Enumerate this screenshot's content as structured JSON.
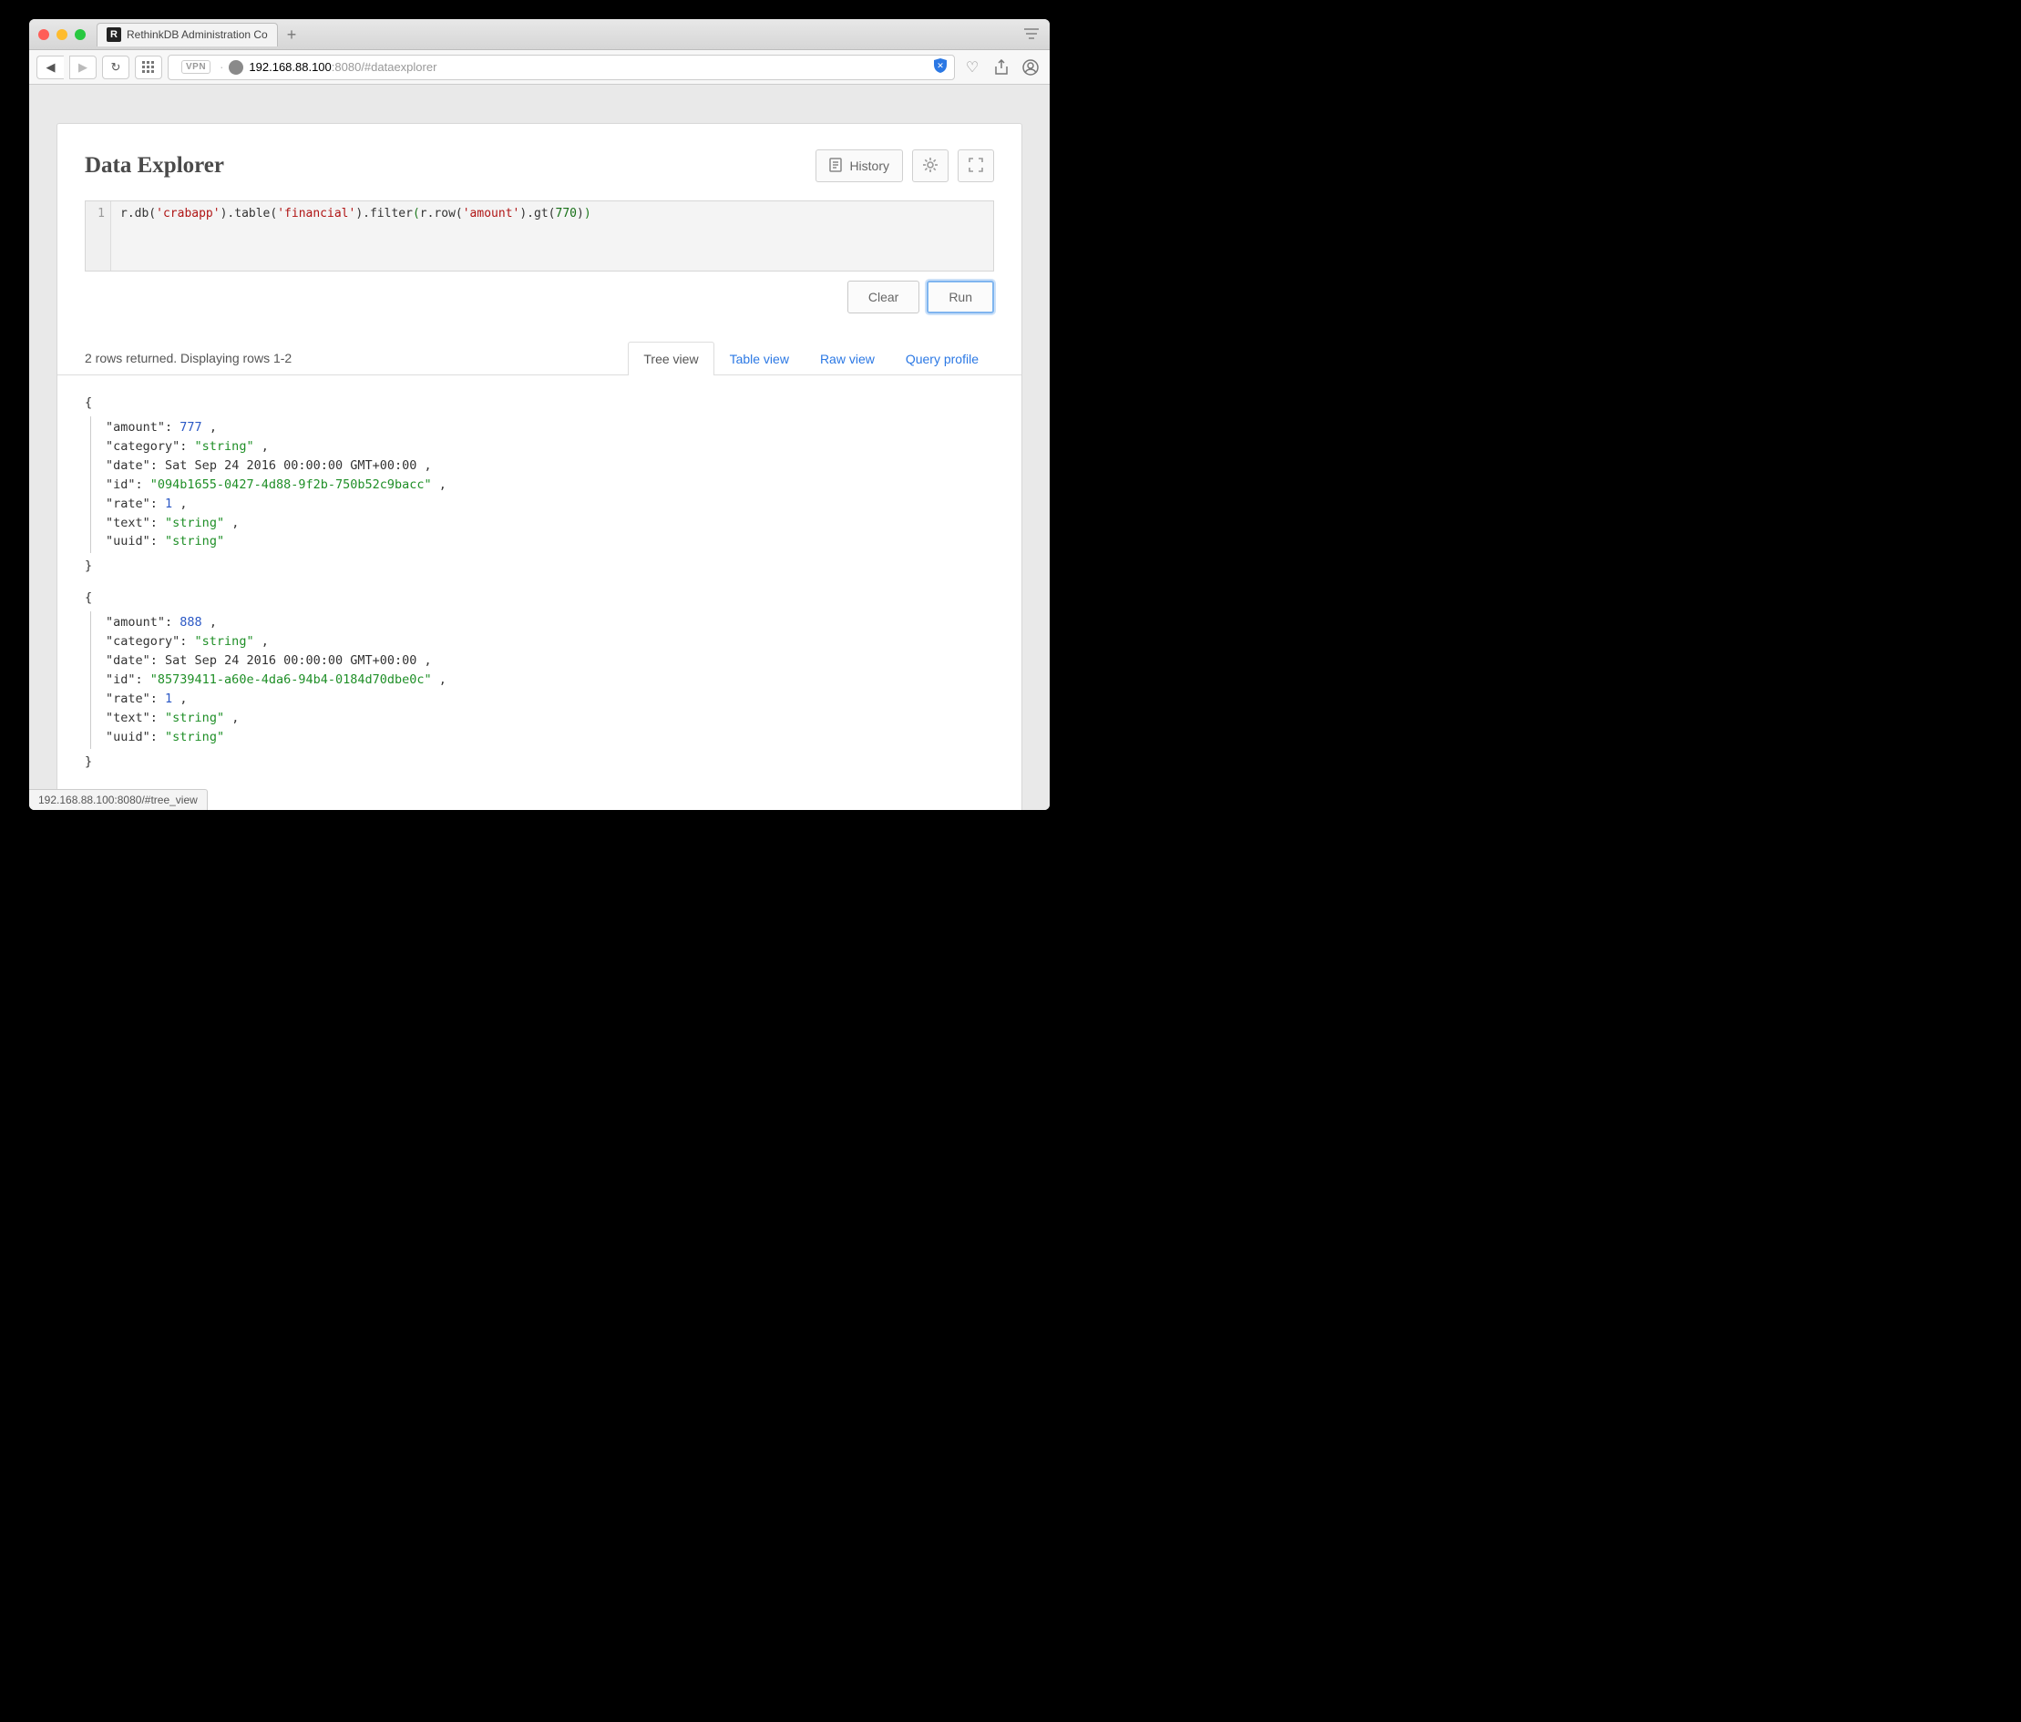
{
  "browser": {
    "tab_title": "RethinkDB Administration Co",
    "url_host": "192.168.88.100",
    "url_rest": ":8080/#dataexplorer",
    "vpn_label": "VPN",
    "status_hover": "192.168.88.100:8080/#tree_view"
  },
  "page": {
    "title": "Data Explorer",
    "history_label": "History"
  },
  "editor": {
    "line_no": "1",
    "tokens": {
      "t1": "r.db(",
      "s1": "'crabapp'",
      "t2": ").table(",
      "s2": "'financial'",
      "t3": ").filter",
      "p_open": "(",
      "t4": "r.row(",
      "s3": "'amount'",
      "t5": ").gt(",
      "n1": "770",
      "t6": ")",
      "p_close": ")"
    }
  },
  "actions": {
    "clear": "Clear",
    "run": "Run"
  },
  "results_meta": {
    "summary": "2 rows returned. Displaying rows 1-2",
    "tabs": {
      "tree": "Tree view",
      "table": "Table view",
      "raw": "Raw view",
      "profile": "Query profile"
    }
  },
  "rows": [
    {
      "amount_key": "\"amount\"",
      "amount_val": "777",
      "category_key": "\"category\"",
      "category_val": "\"string\"",
      "date_key": "\"date\"",
      "date_val": "Sat Sep 24 2016 00:00:00 GMT+00:00",
      "id_key": "\"id\"",
      "id_val": "\"094b1655-0427-4d88-9f2b-750b52c9bacc\"",
      "rate_key": "\"rate\"",
      "rate_val": "1",
      "text_key": "\"text\"",
      "text_val": "\"string\"",
      "uuid_key": "\"uuid\"",
      "uuid_val": "\"string\""
    },
    {
      "amount_key": "\"amount\"",
      "amount_val": "888",
      "category_key": "\"category\"",
      "category_val": "\"string\"",
      "date_key": "\"date\"",
      "date_val": "Sat Sep 24 2016 00:00:00 GMT+00:00",
      "id_key": "\"id\"",
      "id_val": "\"85739411-a60e-4da6-94b4-0184d70dbe0c\"",
      "rate_key": "\"rate\"",
      "rate_val": "1",
      "text_key": "\"text\"",
      "text_val": "\"string\"",
      "uuid_key": "\"uuid\"",
      "uuid_val": "\"string\""
    }
  ]
}
